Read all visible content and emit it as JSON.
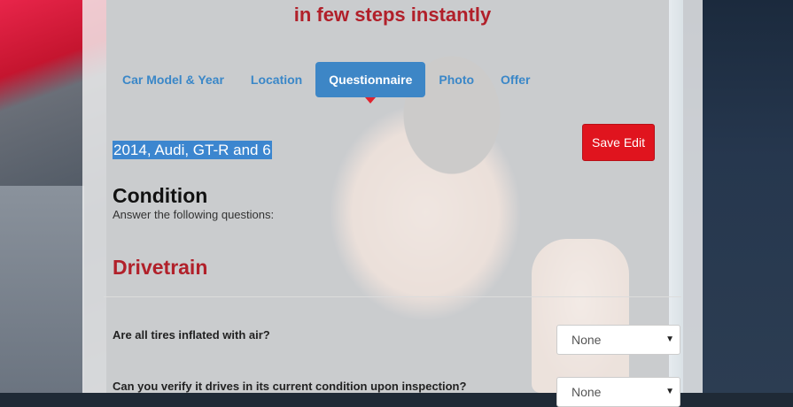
{
  "header": {
    "tagline": "in few steps instantly"
  },
  "tabs": [
    {
      "label": "Car Model & Year"
    },
    {
      "label": "Location"
    },
    {
      "label": "Questionnaire"
    },
    {
      "label": "Photo"
    },
    {
      "label": "Offer"
    }
  ],
  "active_tab": "Questionnaire",
  "vehicle": {
    "summary": "2014, Audi, GT-R and 6"
  },
  "actions": {
    "save_edit": "Save Edit"
  },
  "condition": {
    "title": "Condition",
    "subtitle": "Answer the following questions:"
  },
  "section": {
    "title": "Drivetrain"
  },
  "questions": [
    {
      "text": "Are all tires inflated with air?",
      "selected": "None"
    },
    {
      "text": "Can you verify it drives in its current condition upon inspection?",
      "selected": "None"
    }
  ],
  "colors": {
    "accent_red": "#b1202a",
    "tab_active_blue": "#3d86c6",
    "button_red": "#e0141e",
    "link_blue": "#3a87c8"
  }
}
